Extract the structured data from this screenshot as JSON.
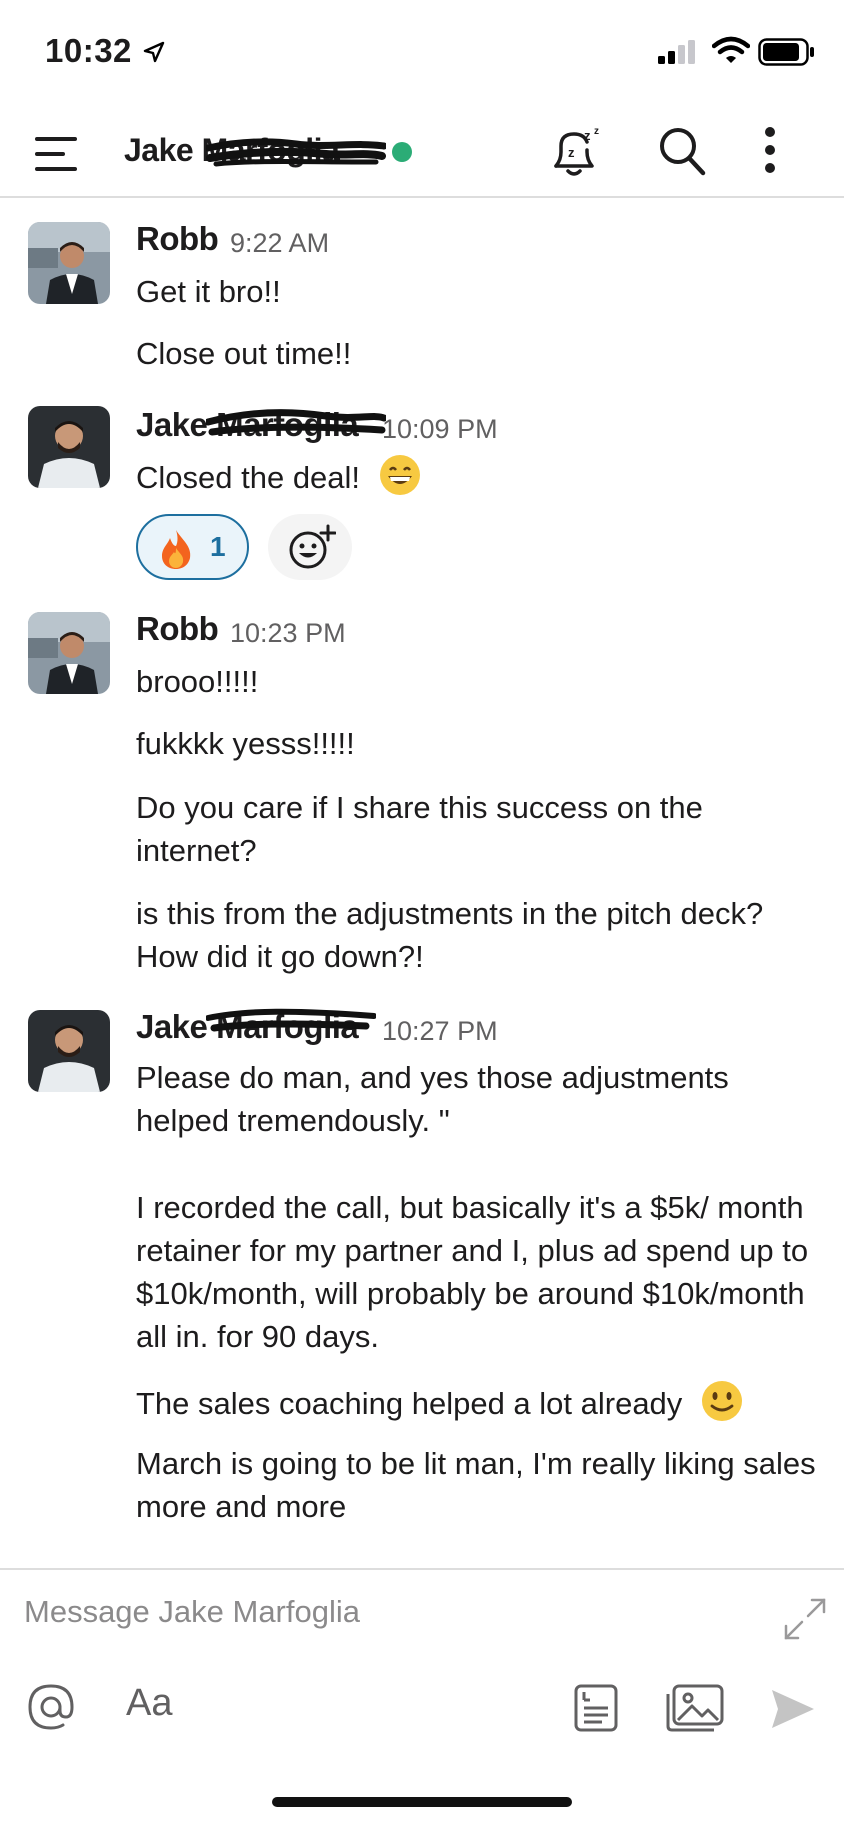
{
  "status_bar": {
    "time": "10:32",
    "icons": [
      "location-arrow-icon",
      "cellular-signal-icon",
      "wifi-icon",
      "battery-icon"
    ]
  },
  "header": {
    "title": "Jake Marfoglia",
    "presence": "active",
    "presence_color": "#2bac76",
    "icons": [
      "hamburger-menu-icon",
      "snooze-bell-icon",
      "search-icon",
      "more-vertical-icon"
    ]
  },
  "messages": [
    {
      "sender": "Robb",
      "time": "9:22 AM",
      "lines": [
        "Get it bro!!",
        "Close out time!!"
      ]
    },
    {
      "sender": "Jake Marfoglia",
      "time": "10:09 PM",
      "lines": [
        "Closed the deal!"
      ],
      "inline_emoji": "grinning-face-emoji",
      "reactions": [
        {
          "emoji": "fire-emoji",
          "count": "1"
        }
      ]
    },
    {
      "sender": "Robb",
      "time": "10:23 PM",
      "lines": [
        "brooo!!!!!",
        "fukkkk yesss!!!!!",
        "Do you care if I share this success on the internet?",
        "is this from the adjustments in the pitch deck?  How did it go down?!"
      ]
    },
    {
      "sender": "Jake Marfoglia",
      "time": "10:27 PM",
      "lines": [
        "Please do man, and yes those adjustments helped tremendously. \"",
        "I recorded the call, but basically it's a $5k/ month retainer for my partner and I, plus ad spend up to $10k/month, will probably be around $10k/month all in. for 90 days.",
        "The sales coaching helped a lot already",
        "March is going to be lit man, I'm really liking sales more and more"
      ],
      "inline_emoji": "slightly-smiling-face-emoji"
    }
  ],
  "composer": {
    "placeholder": "Message Jake Marfoglia",
    "format_label": "Aa",
    "icons": [
      "expand-icon",
      "at-mention-icon",
      "shortcuts-icon",
      "photo-gallery-icon",
      "send-icon"
    ]
  },
  "colors": {
    "accent_link": "#1d6f9f",
    "presence_green": "#2bac76",
    "text": "#1d1c1d",
    "muted": "#616061"
  }
}
